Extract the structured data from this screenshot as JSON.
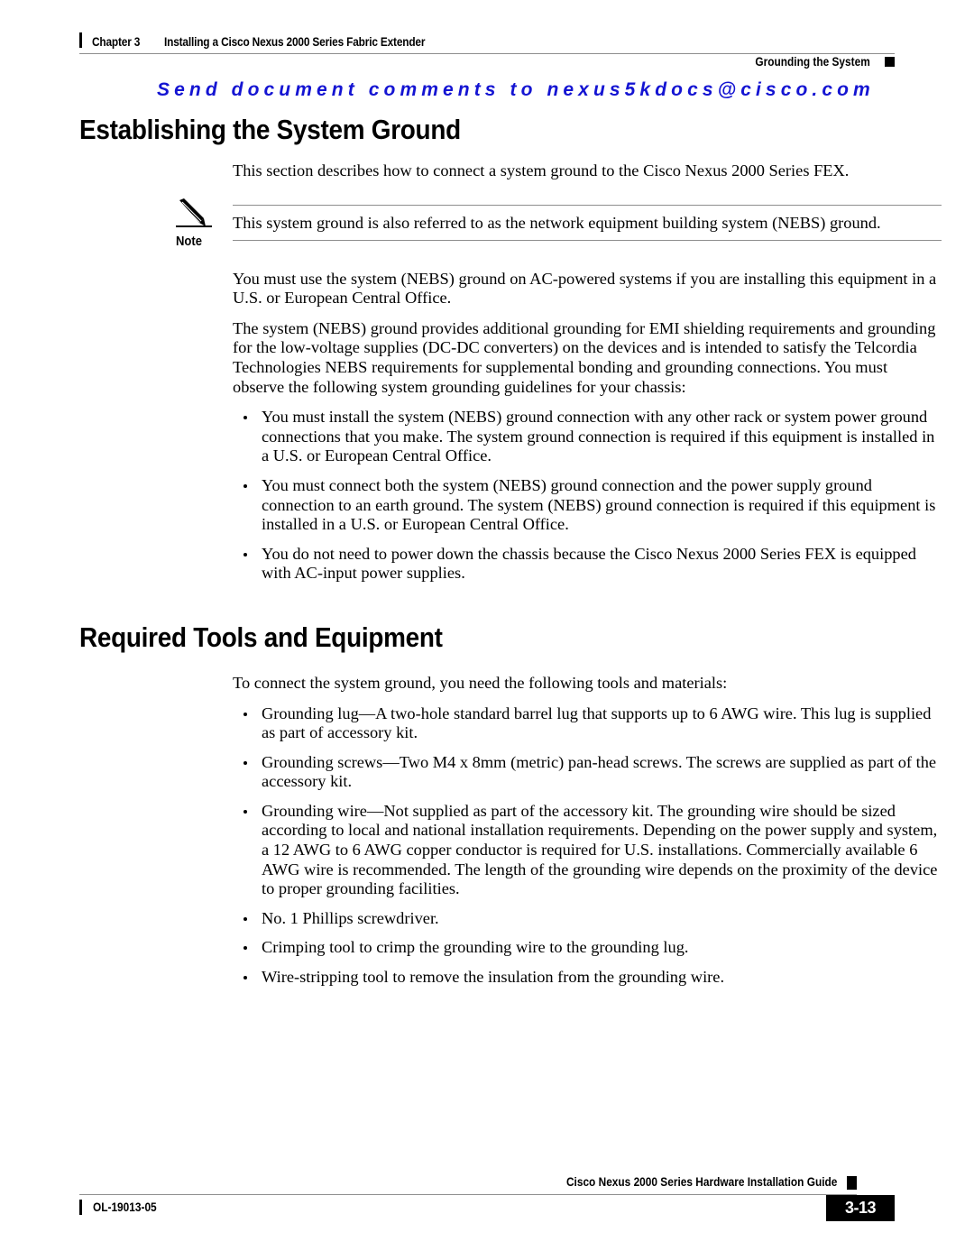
{
  "header": {
    "chapter_label": "Chapter 3",
    "chapter_title": "Installing a Cisco Nexus 2000 Series Fabric Extender",
    "section_title": "Grounding the System"
  },
  "banner": {
    "text": "Send document comments to nexus5kdocs@cisco.com",
    "color": "#1414d2"
  },
  "sections": [
    {
      "heading": "Establishing the System Ground",
      "intro": "This section describes how to connect a system ground to the Cisco Nexus 2000 Series FEX.",
      "note": {
        "label": "Note",
        "text": "This system ground is also referred to as the network equipment building system (NEBS) ground."
      },
      "paragraphs": [
        "You must use the system (NEBS) ground on AC-powered systems if you are installing this equipment in a U.S. or European Central Office.",
        "The system (NEBS) ground provides additional grounding for EMI shielding requirements and grounding for the low-voltage supplies (DC-DC converters) on the devices and is intended to satisfy the Telcordia Technologies NEBS requirements for supplemental bonding and grounding connections. You must observe the following system grounding guidelines for your chassis:"
      ],
      "bullets": [
        "You must install the system (NEBS) ground connection with any other rack or system power ground connections that you make. The system ground connection is required if this equipment is installed in a U.S. or European Central Office.",
        "You must connect both the system (NEBS) ground connection and the power supply ground connection to an earth ground. The system (NEBS) ground connection is required if this equipment is installed in a U.S. or European Central Office.",
        "You do not need to power down the chassis because the Cisco Nexus 2000 Series FEX is equipped with AC-input power supplies."
      ]
    },
    {
      "heading": "Required Tools and Equipment",
      "intro": "To connect the system ground, you need the following tools and materials:",
      "bullets": [
        "Grounding lug—A two-hole standard barrel lug that supports up to 6 AWG wire. This lug is supplied as part of accessory kit.",
        "Grounding screws—Two M4 x 8mm (metric) pan-head screws. The screws are supplied as part of the accessory kit.",
        "Grounding wire—Not supplied as part of the accessory kit. The grounding wire should be sized according to local and national installation requirements. Depending on the power supply and system, a 12 AWG to 6 AWG copper conductor is required for U.S. installations. Commercially available 6 AWG wire is recommended. The length of the grounding wire depends on the proximity of the device to proper grounding facilities.",
        "No. 1 Phillips screwdriver.",
        "Crimping tool to crimp the grounding wire to the grounding lug.",
        "Wire-stripping tool to remove the insulation from the grounding wire."
      ]
    }
  ],
  "footer": {
    "guide_title": "Cisco Nexus 2000 Series Hardware Installation Guide",
    "doc_id": "OL-19013-05",
    "page_number": "3-13"
  }
}
